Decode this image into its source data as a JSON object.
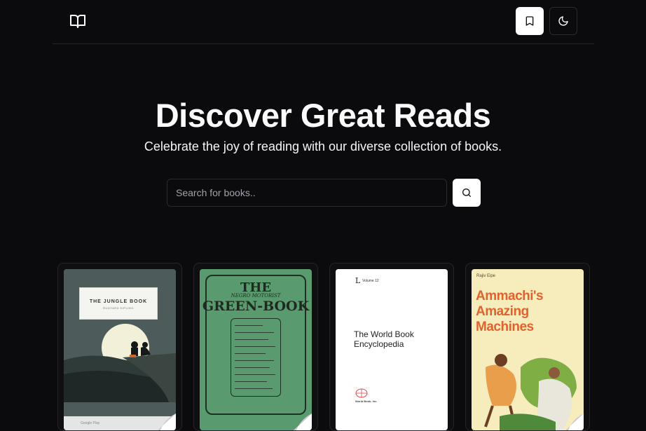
{
  "header": {
    "bookmark_label": "Bookmarks",
    "theme_label": "Toggle theme"
  },
  "hero": {
    "title": "Discover Great Reads",
    "subtitle": "Celebrate the joy of reading with our diverse collection of books."
  },
  "search": {
    "placeholder": "Search for books.."
  },
  "books": [
    {
      "cover_title": "THE JUNGLE BOOK",
      "cover_author": "RUDYARD KIPLING",
      "cover_footer": "Google Play"
    },
    {
      "cover_title_1": "THE",
      "cover_subtitle": "NEGRO MOTORIST",
      "cover_title_2": "GREEN-BOOK"
    },
    {
      "cover_letter": "L",
      "cover_volume": "Volume 12",
      "cover_title": "The World Book Encyclopedia",
      "cover_publisher": "World Book, Inc."
    },
    {
      "cover_author": "Rajiv Eipe",
      "cover_title": "Ammachi's Amazing Machines"
    }
  ],
  "colors": {
    "background": "#0b0b0e",
    "accent": "#ffffff",
    "border": "#26262a"
  }
}
